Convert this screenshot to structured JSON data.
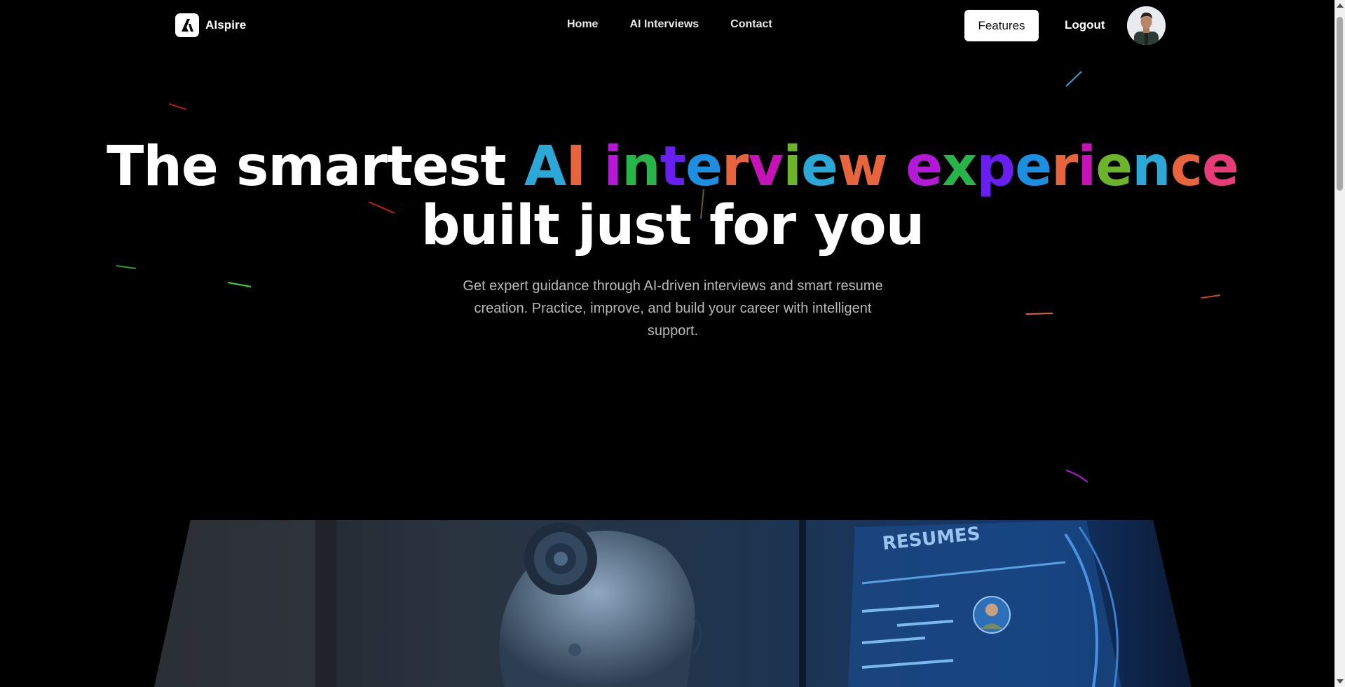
{
  "nav": {
    "brand": "AIspire",
    "links": [
      {
        "label": "Home"
      },
      {
        "label": "AI Interviews"
      },
      {
        "label": "Contact"
      }
    ],
    "features_label": "Features",
    "logout_label": "Logout"
  },
  "hero": {
    "line1_plain": "The smartest ",
    "line1_gradient": [
      {
        "ch": "A",
        "color": "#2ba7d8"
      },
      {
        "ch": "I",
        "color": "#e8643c"
      },
      {
        "ch": " ",
        "color": "#ffffff"
      },
      {
        "ch": "i",
        "color": "#b319d6"
      },
      {
        "ch": "n",
        "color": "#27b54a"
      },
      {
        "ch": "t",
        "color": "#6a1ff2"
      },
      {
        "ch": "e",
        "color": "#1d8fe0"
      },
      {
        "ch": "r",
        "color": "#e8643c"
      },
      {
        "ch": "v",
        "color": "#c613b8"
      },
      {
        "ch": "i",
        "color": "#6cb52a"
      },
      {
        "ch": "e",
        "color": "#2ba7d8"
      },
      {
        "ch": "w",
        "color": "#e8643c"
      },
      {
        "ch": " ",
        "color": "#ffffff"
      },
      {
        "ch": "e",
        "color": "#b319d6"
      },
      {
        "ch": "x",
        "color": "#27b54a"
      },
      {
        "ch": "p",
        "color": "#6a1ff2"
      },
      {
        "ch": "e",
        "color": "#1d8fe0"
      },
      {
        "ch": "r",
        "color": "#e8643c"
      },
      {
        "ch": "i",
        "color": "#c613b8"
      },
      {
        "ch": "e",
        "color": "#6cb52a"
      },
      {
        "ch": "n",
        "color": "#2ba7d8"
      },
      {
        "ch": "c",
        "color": "#e8643c"
      },
      {
        "ch": "e",
        "color": "#e83c78"
      }
    ],
    "line2": "built just for you",
    "subtitle": "Get expert guidance through AI-driven interviews and smart resume creation. Practice, improve, and build your career with intelligent support."
  },
  "panel": {
    "heading": "RESUMES"
  }
}
